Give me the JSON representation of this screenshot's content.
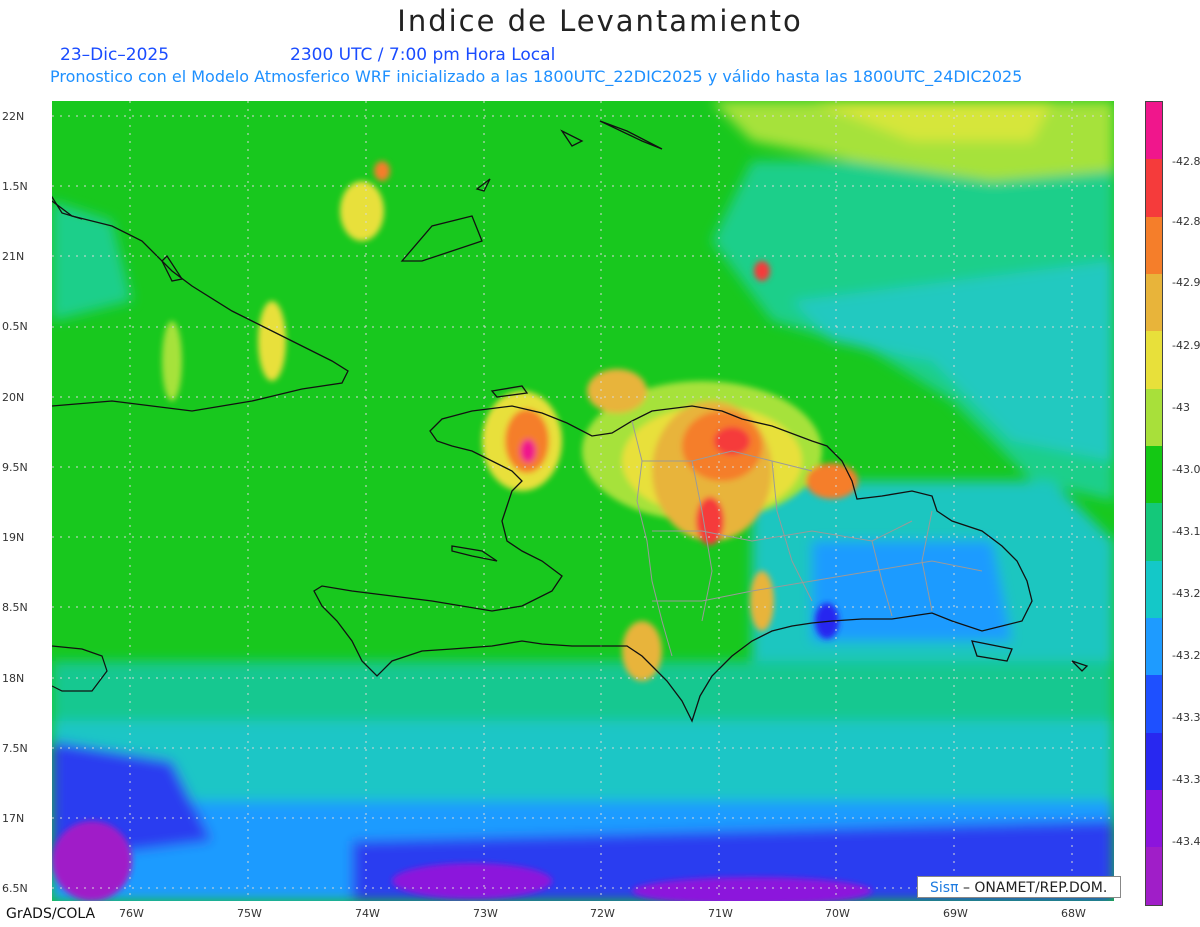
{
  "header": {
    "title": "Indice de Levantamiento",
    "date": "23–Dic–2025",
    "time": "2300 UTC / 7:00 pm Hora Local",
    "subtitle": "Pronostico con el Modelo Atmosferico WRF inicializado a las 1800UTC_22DIC2025 y válido hasta las  1800UTC_24DIC2025"
  },
  "map": {
    "lat_labels": [
      "22N",
      "1.5N",
      "21N",
      "0.5N",
      "20N",
      "9.5N",
      "19N",
      "8.5N",
      "18N",
      "7.5N",
      "17N",
      "6.5N"
    ],
    "lon_labels": [
      "76W",
      "75W",
      "74W",
      "73W",
      "72W",
      "71W",
      "70W",
      "69W",
      "68W"
    ]
  },
  "colorbar": {
    "labels": [
      "-42.8",
      "-42.8",
      "-42.9",
      "-42.9",
      "-43",
      "-43.0",
      "-43.1",
      "-43.2",
      "-43.2",
      "-43.3",
      "-43.3",
      "-43.4"
    ],
    "colors": [
      "#f0168c",
      "#f53b3b",
      "#f57e2a",
      "#e8b43a",
      "#e8e03a",
      "#a8e03a",
      "#14c814",
      "#14c87a",
      "#14c8c8",
      "#1e9bff",
      "#1e50ff",
      "#2828f0",
      "#8c14dc",
      "#a01ec8"
    ]
  },
  "footer": {
    "credit_logo": "Sisπ",
    "credit_text": " – ONAMET/REP.DOM.",
    "software": "GrADS/COLA"
  }
}
